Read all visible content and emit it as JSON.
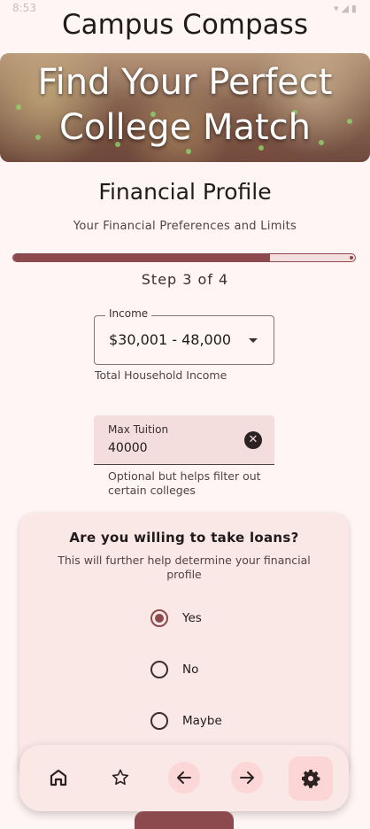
{
  "status_bar": {
    "time": "8:53"
  },
  "app": {
    "title": "Campus Compass"
  },
  "hero": {
    "title": "Find Your Perfect College Match"
  },
  "section": {
    "title": "Financial Profile",
    "subtitle": "Your Financial Preferences and Limits"
  },
  "progress": {
    "step_text": "Step 3 of 4",
    "fraction": 0.75
  },
  "income": {
    "label": "Income",
    "value": "$30,001 - 48,000",
    "helper": "Total Household Income"
  },
  "tuition": {
    "label": "Max Tuition",
    "value": "40000",
    "helper": "Optional but helps filter out certain colleges"
  },
  "loans": {
    "question": "Are you willing to take loans?",
    "subtitle": "This will further help determine your financial profile",
    "options": [
      {
        "label": "Yes",
        "selected": true
      },
      {
        "label": "No",
        "selected": false
      },
      {
        "label": "Maybe",
        "selected": false
      }
    ]
  },
  "nav": {
    "items": [
      "home-icon",
      "star-icon",
      "arrow-left-icon",
      "arrow-right-icon",
      "gear-icon"
    ],
    "active": "gear-icon"
  },
  "colors": {
    "accent": "#8c4a4f",
    "surface": "#fae8e7",
    "background": "#fff5f4"
  }
}
